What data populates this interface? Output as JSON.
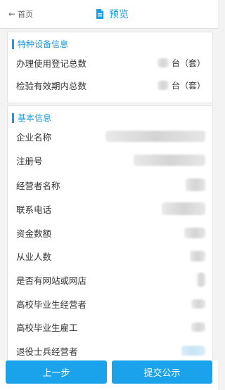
{
  "header": {
    "back_label": "首页",
    "title": "预览"
  },
  "special_equipment": {
    "section_title": "特种设备信息",
    "rows": [
      {
        "label": "办理使用登记总数",
        "unit": "台（套）"
      },
      {
        "label": "检验有效期内总数",
        "unit": "台（套）"
      }
    ]
  },
  "basic_info": {
    "section_title": "基本信息",
    "rows": [
      {
        "label": "企业名称"
      },
      {
        "label": "注册号"
      },
      {
        "label": "经营者名称"
      },
      {
        "label": "联系电话"
      },
      {
        "label": "资金数额"
      },
      {
        "label": "从业人数"
      },
      {
        "label": "是否有网站或网店"
      },
      {
        "label": "高校毕业生经营者"
      },
      {
        "label": "高校毕业生雇工"
      },
      {
        "label": "退役士兵经营者"
      }
    ]
  },
  "footer": {
    "prev_label": "上一步",
    "submit_label": "提交公示"
  },
  "colors": {
    "accent": "#1aa3ea",
    "section_title": "#1a9bdc"
  }
}
